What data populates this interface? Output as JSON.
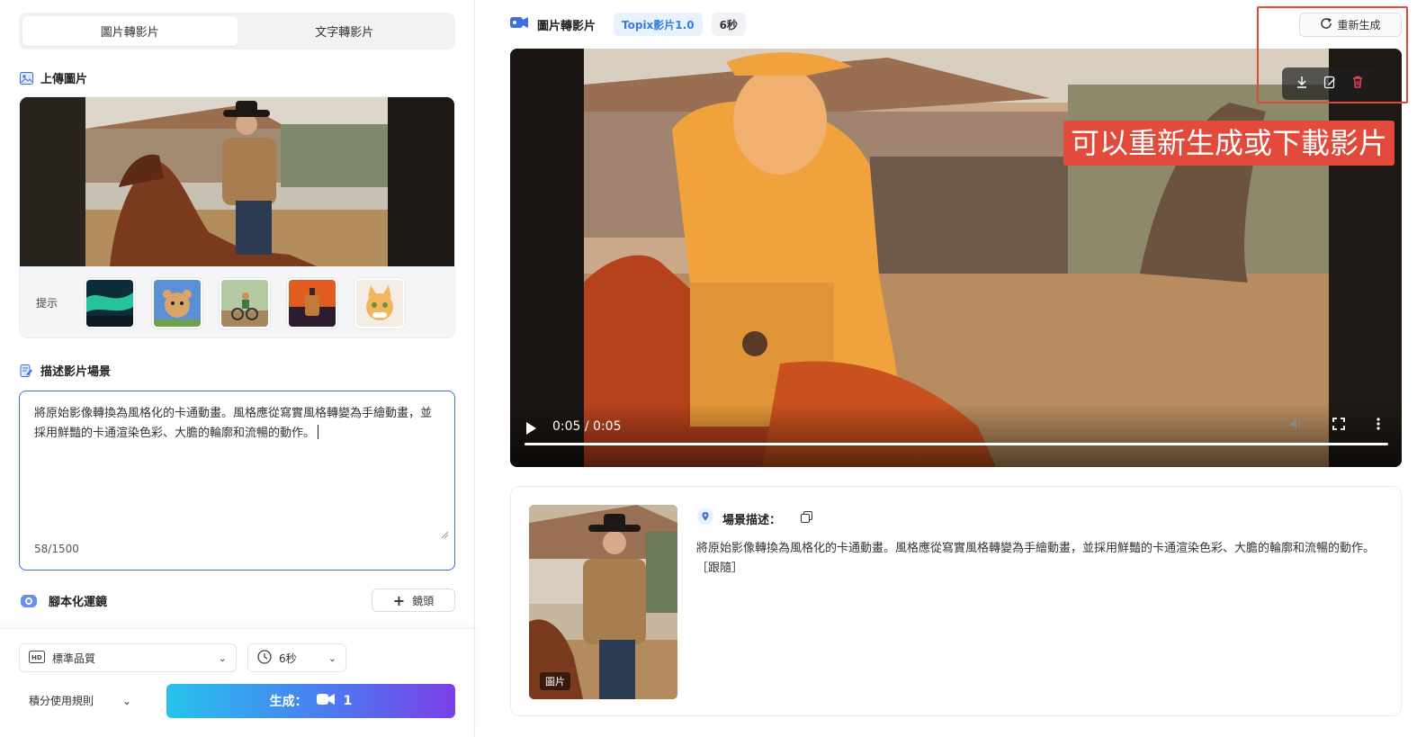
{
  "left": {
    "tabs": [
      {
        "label": "圖片轉影片",
        "active": true
      },
      {
        "label": "文字轉影片",
        "active": false
      }
    ],
    "upload_title": "上傳圖片",
    "hint_label": "提示",
    "hint_thumbs": [
      "aurora-thumb",
      "teddy-bear-thumb",
      "cyclist-thumb",
      "perfume-thumb",
      "kitten-thumb"
    ],
    "describe_title": "描述影片場景",
    "prompt_text": "將原始影像轉換為風格化的卡通動畫。風格應從寫實風格轉變為手繪動畫，並採用鮮豔的卡通渲染色彩、大膽的輪廓和流暢的動作。",
    "char_count": "58/1500",
    "storyboard_title": "腳本化運鏡",
    "lens_button": "鏡頭",
    "quality_select": "標準品質",
    "duration_select": "6秒",
    "rules_label": "積分使用規則",
    "generate_label": "生成：",
    "generate_cost": "1"
  },
  "right": {
    "title": "圖片轉影片",
    "model_badge": "Topix影片1.0",
    "duration_badge": "6秒",
    "regenerate_label": "重新生成",
    "callout": "可以重新生成或下載影片",
    "time": "0:05 / 0:05",
    "progress": 1.0,
    "scene_label": "場景描述：",
    "scene_text": "將原始影像轉換為風格化的卡通動畫。風格應從寫實風格轉變為手繪動畫，並採用鮮豔的卡通渲染色彩、大膽的輪廓和流暢的動作。［跟隨］",
    "image_tag": "圖片"
  },
  "colors": {
    "accent_blue": "#3d6fe0",
    "gradient_start": "#27c3ec",
    "gradient_end": "#7b3fe7",
    "callout_red": "#e24a3c",
    "delete_red": "#e8414f"
  }
}
